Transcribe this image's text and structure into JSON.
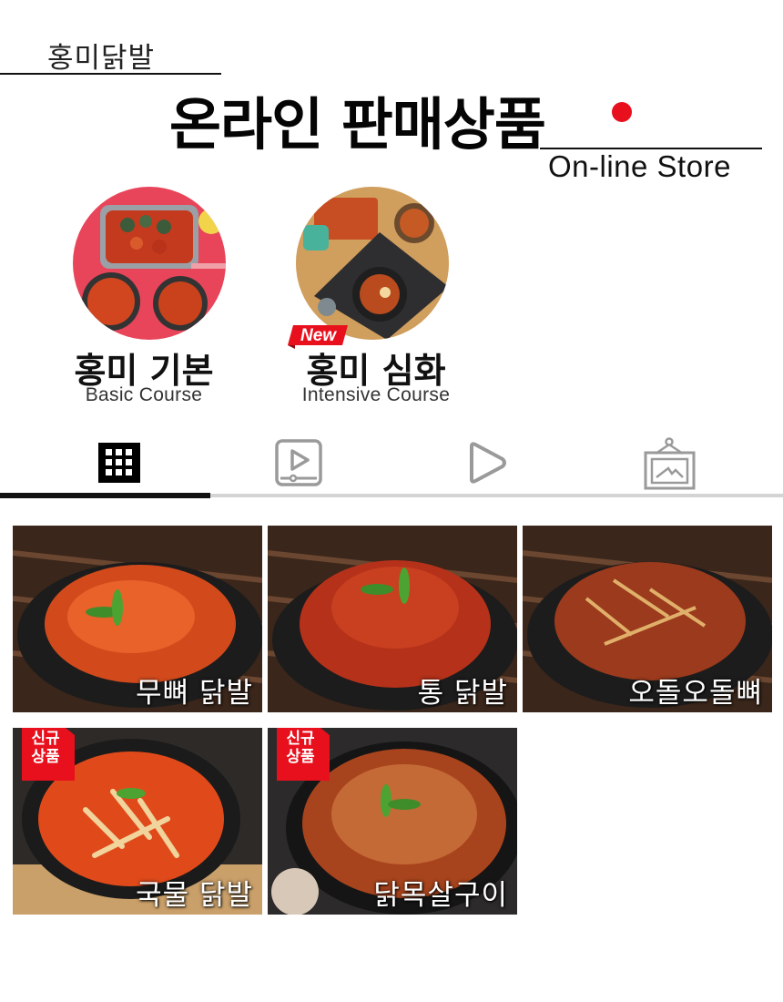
{
  "header": {
    "brand": "홍미닭발",
    "title": "온라인 판매상품",
    "subtitle": "On-line Store"
  },
  "highlights": [
    {
      "name": "홍미 기본",
      "subtitle": "Basic Course",
      "badge": ""
    },
    {
      "name": "홍미 심화",
      "subtitle": "Intensive Course",
      "badge": "New"
    }
  ],
  "tabs": [
    {
      "icon": "grid-icon",
      "active": true
    },
    {
      "icon": "video-play-icon",
      "active": false
    },
    {
      "icon": "play-icon",
      "active": false
    },
    {
      "icon": "photo-frame-icon",
      "active": false
    }
  ],
  "products": [
    {
      "label": "무뼈 닭발",
      "new_tag": false
    },
    {
      "label": "통 닭발",
      "new_tag": false
    },
    {
      "label": "오돌오돌뼈",
      "new_tag": false
    },
    {
      "label": "국물 닭발",
      "new_tag": true,
      "tag_line1": "신규",
      "tag_line2": "상품"
    },
    {
      "label": "닭목살구이",
      "new_tag": true,
      "tag_line1": "신규",
      "tag_line2": "상품"
    }
  ],
  "colors": {
    "accent": "#e8101d",
    "text": "#111111",
    "tab_track": "#d4d4d4"
  }
}
